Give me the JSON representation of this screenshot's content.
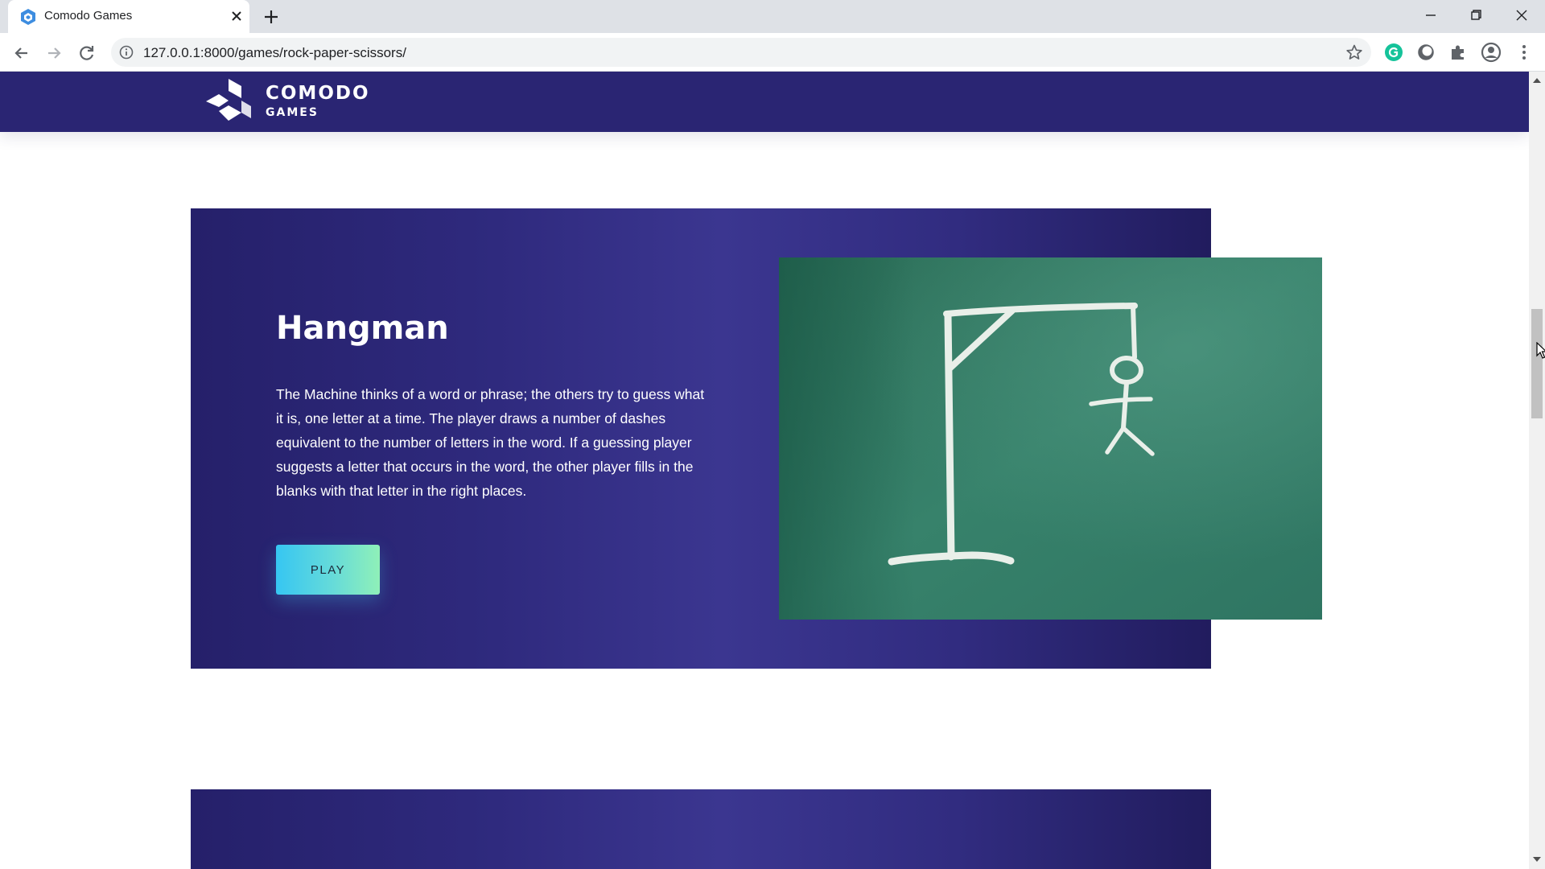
{
  "browser": {
    "tab_title": "Comodo Games",
    "url": "127.0.0.1:8000/games/rock-paper-scissors/",
    "icons": [
      "comodo-favicon-icon",
      "close-icon",
      "plus-icon",
      "minimize-icon",
      "restore-icon",
      "window-close-icon",
      "back-icon",
      "forward-icon",
      "reload-icon",
      "info-icon",
      "star-icon",
      "grammarly-icon",
      "extension-circle-icon",
      "puzzle-icon",
      "profile-icon",
      "more-vert-icon"
    ]
  },
  "site": {
    "logo_line1": "COMODO",
    "logo_line2": "GAMES",
    "header_color": "#2a2573"
  },
  "game": {
    "title": "Hangman",
    "description": "The Machine thinks of a word or phrase; the others try to guess what it is, one letter at a time. The player draws a number of dashes equivalent to the number of letters in the word. If a guessing player suggests a letter that occurs in the word, the other player fills in the blanks with that letter in the right places.",
    "play_label": "PLAY",
    "image": "hangman-chalkboard-drawing"
  },
  "colors": {
    "card_dark": "#25206a",
    "card_mid": "#3b3690",
    "button_start": "#36c6f2",
    "button_end": "#8ff0b8",
    "chalkboard": "#2f7a64"
  }
}
